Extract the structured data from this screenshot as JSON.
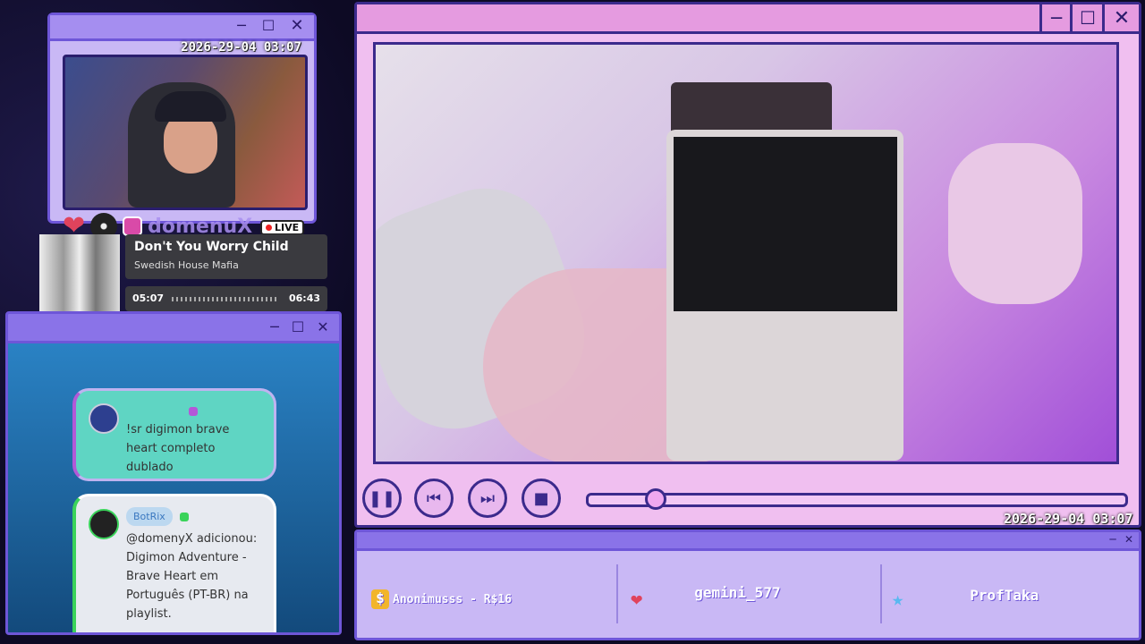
{
  "camera": {
    "timestamp": "2026-29-04 03:07",
    "live_label": "LIVE",
    "handle": "domenuX"
  },
  "music": {
    "title": "Don't You Worry Child",
    "artist": "Swedish House Mafia",
    "elapsed": "05:07",
    "total": "06:43"
  },
  "chat": {
    "messages": [
      {
        "username": "",
        "text": "!sr digimon brave heart completo dublado",
        "accent": "#b358d8"
      },
      {
        "username": "BotRix",
        "text": "@domenyX adicionou: Digimon Adventure - Brave Heart em Português (PT-BR) na playlist.",
        "accent": "#3ad35a"
      }
    ]
  },
  "video": {
    "timestamp": "2026-29-04 03:07",
    "progress_fraction": 0.12
  },
  "alerts": {
    "donation": "Anonimusss - R$16",
    "follower": "gemini_577",
    "subscriber": "ProfTaka"
  },
  "colors": {
    "accent": "#6e56d8",
    "video_border": "#3b2a8c",
    "alert_bg": "#c9b8f5"
  }
}
